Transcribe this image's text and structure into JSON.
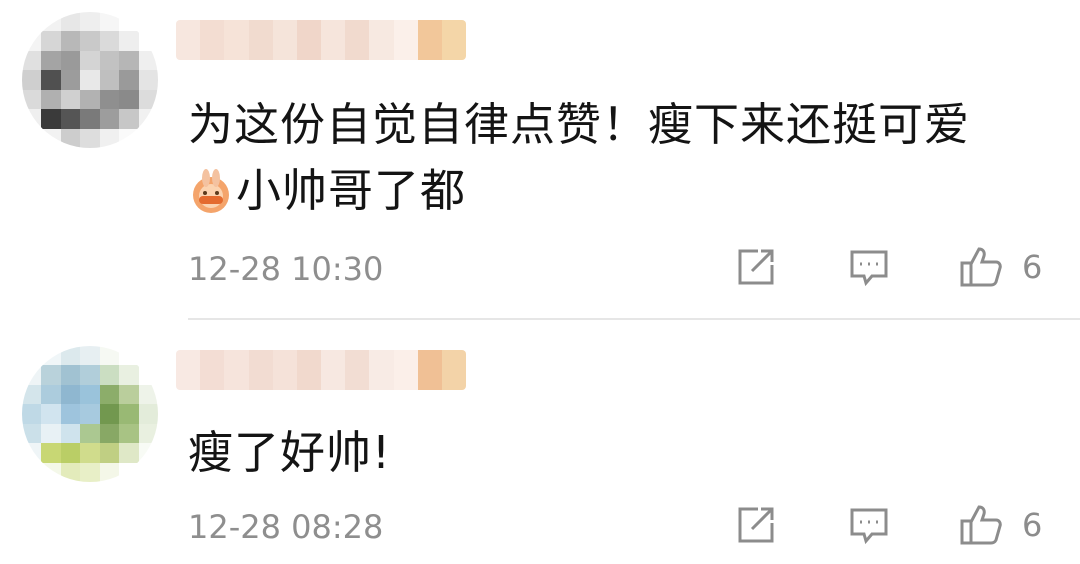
{
  "comments": [
    {
      "text": "为这份自觉自律点赞！瘦下来还挺可爱",
      "text_line2": "小帅哥了都",
      "emoji": "clapping-bear-emoji",
      "time": "12-28 10:30",
      "like_count": "6"
    },
    {
      "text": "瘦了好帅!",
      "time": "12-28 08:28",
      "like_count": "6"
    }
  ],
  "icons": {
    "share": "share-icon",
    "reply": "reply-icon",
    "like": "thumbs-up-icon"
  },
  "colors": {
    "text": "#141414",
    "meta": "#8e8e8e",
    "divider": "#e6e6e6"
  }
}
